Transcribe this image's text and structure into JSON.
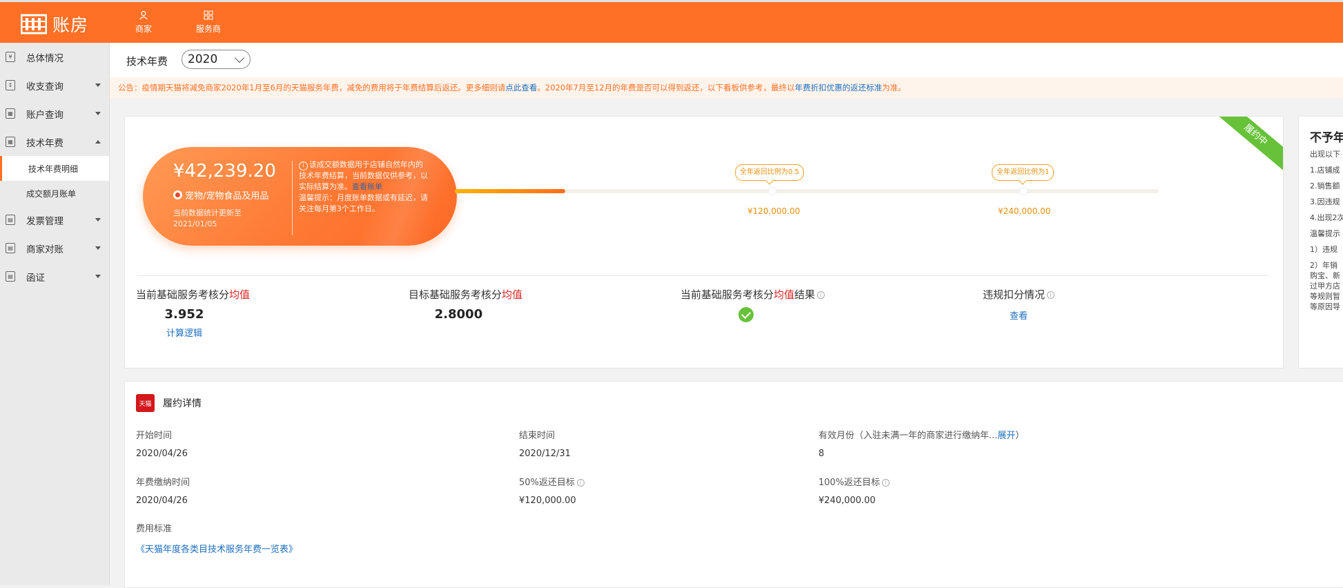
{
  "topbar": {
    "logo_text": "账房",
    "nav": [
      {
        "label": "商家",
        "icon": "user-icon"
      },
      {
        "label": "服务商",
        "icon": "grid-icon"
      }
    ]
  },
  "sidebar": {
    "items": [
      {
        "label": "总体情况",
        "icon": "yen-icon"
      },
      {
        "label": "收支查询",
        "icon": "doc-icon"
      },
      {
        "label": "账户查询",
        "icon": "table-icon"
      },
      {
        "label": "技术年费",
        "icon": "calc-icon"
      },
      {
        "label": "技术年费明细"
      },
      {
        "label": "成交额月账单"
      },
      {
        "label": "发票管理",
        "icon": "invoice-icon"
      },
      {
        "label": "商家对账",
        "icon": "reconcile-icon"
      },
      {
        "label": "函证",
        "icon": "letter-icon"
      }
    ]
  },
  "filter": {
    "label": "技术年费",
    "year": "2020"
  },
  "notice": {
    "part1": "公告：疫情期天猫将减免商家2020年1月至6月的天猫服务年费，减免的费用将于年费结算后返还。更多细则请",
    "link1": "点此查看",
    "part2": "。2020年7月至12月的年费是否可以得到返还，以下看板供参考，最终以",
    "link2": "年费折扣优惠的返还标准",
    "part3": "为准。"
  },
  "summary": {
    "amount": "¥42,239.20",
    "category": "宠物/宠物食品及用品",
    "updated_label": "当前数据统计更新至",
    "updated_date": "2021/01/05",
    "info_text": "该成交额数据用于店铺自然年内的技术年费结算，当前数据仅供参考，以实际结算为准。",
    "info_link": "查看账单",
    "reminder": "温馨提示：月度账单数据或有延迟，请关注每月第3个工作日。",
    "status_ribbon": "履约中"
  },
  "progress": {
    "filled_fraction": 0.157,
    "milestones": [
      {
        "tag": "全年返回比例为0.5",
        "amount": "¥120,000.00"
      },
      {
        "tag": "全年返回比例为1",
        "amount": "¥240,000.00"
      }
    ]
  },
  "metrics": [
    {
      "label_pre": "当前基础服务考核分",
      "label_red": "均值",
      "label_post": "",
      "value": "3.952",
      "link": "计算逻辑"
    },
    {
      "label_pre": "目标基础服务考核分",
      "label_red": "均值",
      "label_post": "",
      "value": "2.8000"
    },
    {
      "label_pre": "当前基础服务考核分",
      "label_red": "均值",
      "label_post": "结果"
    },
    {
      "label_pre": "违规扣分情况",
      "link": "查看"
    }
  ],
  "right_card": {
    "title": "不予年",
    "lines": [
      "出现以下",
      "1.店铺成",
      "2.销售额",
      "3.因违规",
      "4.出现2次",
      "温馨提示",
      "1）违规",
      "2）年销",
      "购宝、新",
      "过甲方店",
      "等规则暂",
      "等原因导"
    ]
  },
  "details": {
    "title": "履约详情",
    "logo_text": "天猫",
    "fields": [
      {
        "label": "开始时间",
        "value": "2020/04/26"
      },
      {
        "label": "结束时间",
        "value": "2020/12/31"
      },
      {
        "label": "有效月份（入驻未满一年的商家进行缴纳年...",
        "label_link": "展开",
        "label_tail": "）",
        "value": "8"
      },
      {
        "label": "年费缴纳时间",
        "value": "2020/04/26"
      },
      {
        "label": "50%返还目标",
        "value": "¥120,000.00"
      },
      {
        "label": "100%返还目标",
        "value": "¥240,000.00"
      }
    ],
    "fee_label": "费用标准",
    "fee_link": "《天猫年度各类目技术服务年费一览表》"
  }
}
